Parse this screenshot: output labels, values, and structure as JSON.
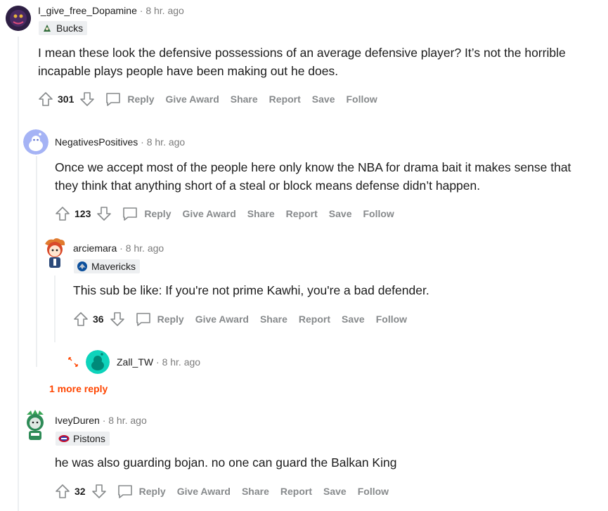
{
  "comments": [
    {
      "username": "I_give_free_Dopamine",
      "time": "· 8 hr. ago",
      "flair": "Bucks",
      "body": "I mean these look the defensive possessions of an average defensive player? It’s not the horrible incapable plays people have been making out he does.",
      "score": "301"
    },
    {
      "username": "NegativesPositives",
      "time": "· 8 hr. ago",
      "body": "Once we accept most of the people here only know the NBA for drama bait it makes sense that they think that anything short of a steal or block means defense didn’t happen.",
      "score": "123"
    },
    {
      "username": "arciemara",
      "time": "· 8 hr. ago",
      "flair": "Mavericks",
      "body": "This sub be like: If you're not prime Kawhi, you're a bad defender.",
      "score": "36"
    },
    {
      "username": "Zall_TW",
      "time": "· 8 hr. ago"
    },
    {
      "username": "IveyDuren",
      "time": "· 8 hr. ago",
      "flair": "Pistons",
      "body": "he was also guarding bojan. no one can guard the Balkan King",
      "score": "32"
    }
  ],
  "actions": {
    "reply": "Reply",
    "give_award": "Give Award",
    "share": "Share",
    "report": "Report",
    "save": "Save",
    "follow": "Follow"
  },
  "more_replies": "1 more reply",
  "colors": {
    "action_gray": "#878a8c",
    "more_reply_orange": "#ff4500",
    "thread_line": "#edeff1",
    "flair_bg": "#edeff1"
  },
  "icons": [
    "upvote-icon",
    "downvote-icon",
    "comment-icon",
    "expand-icon"
  ]
}
